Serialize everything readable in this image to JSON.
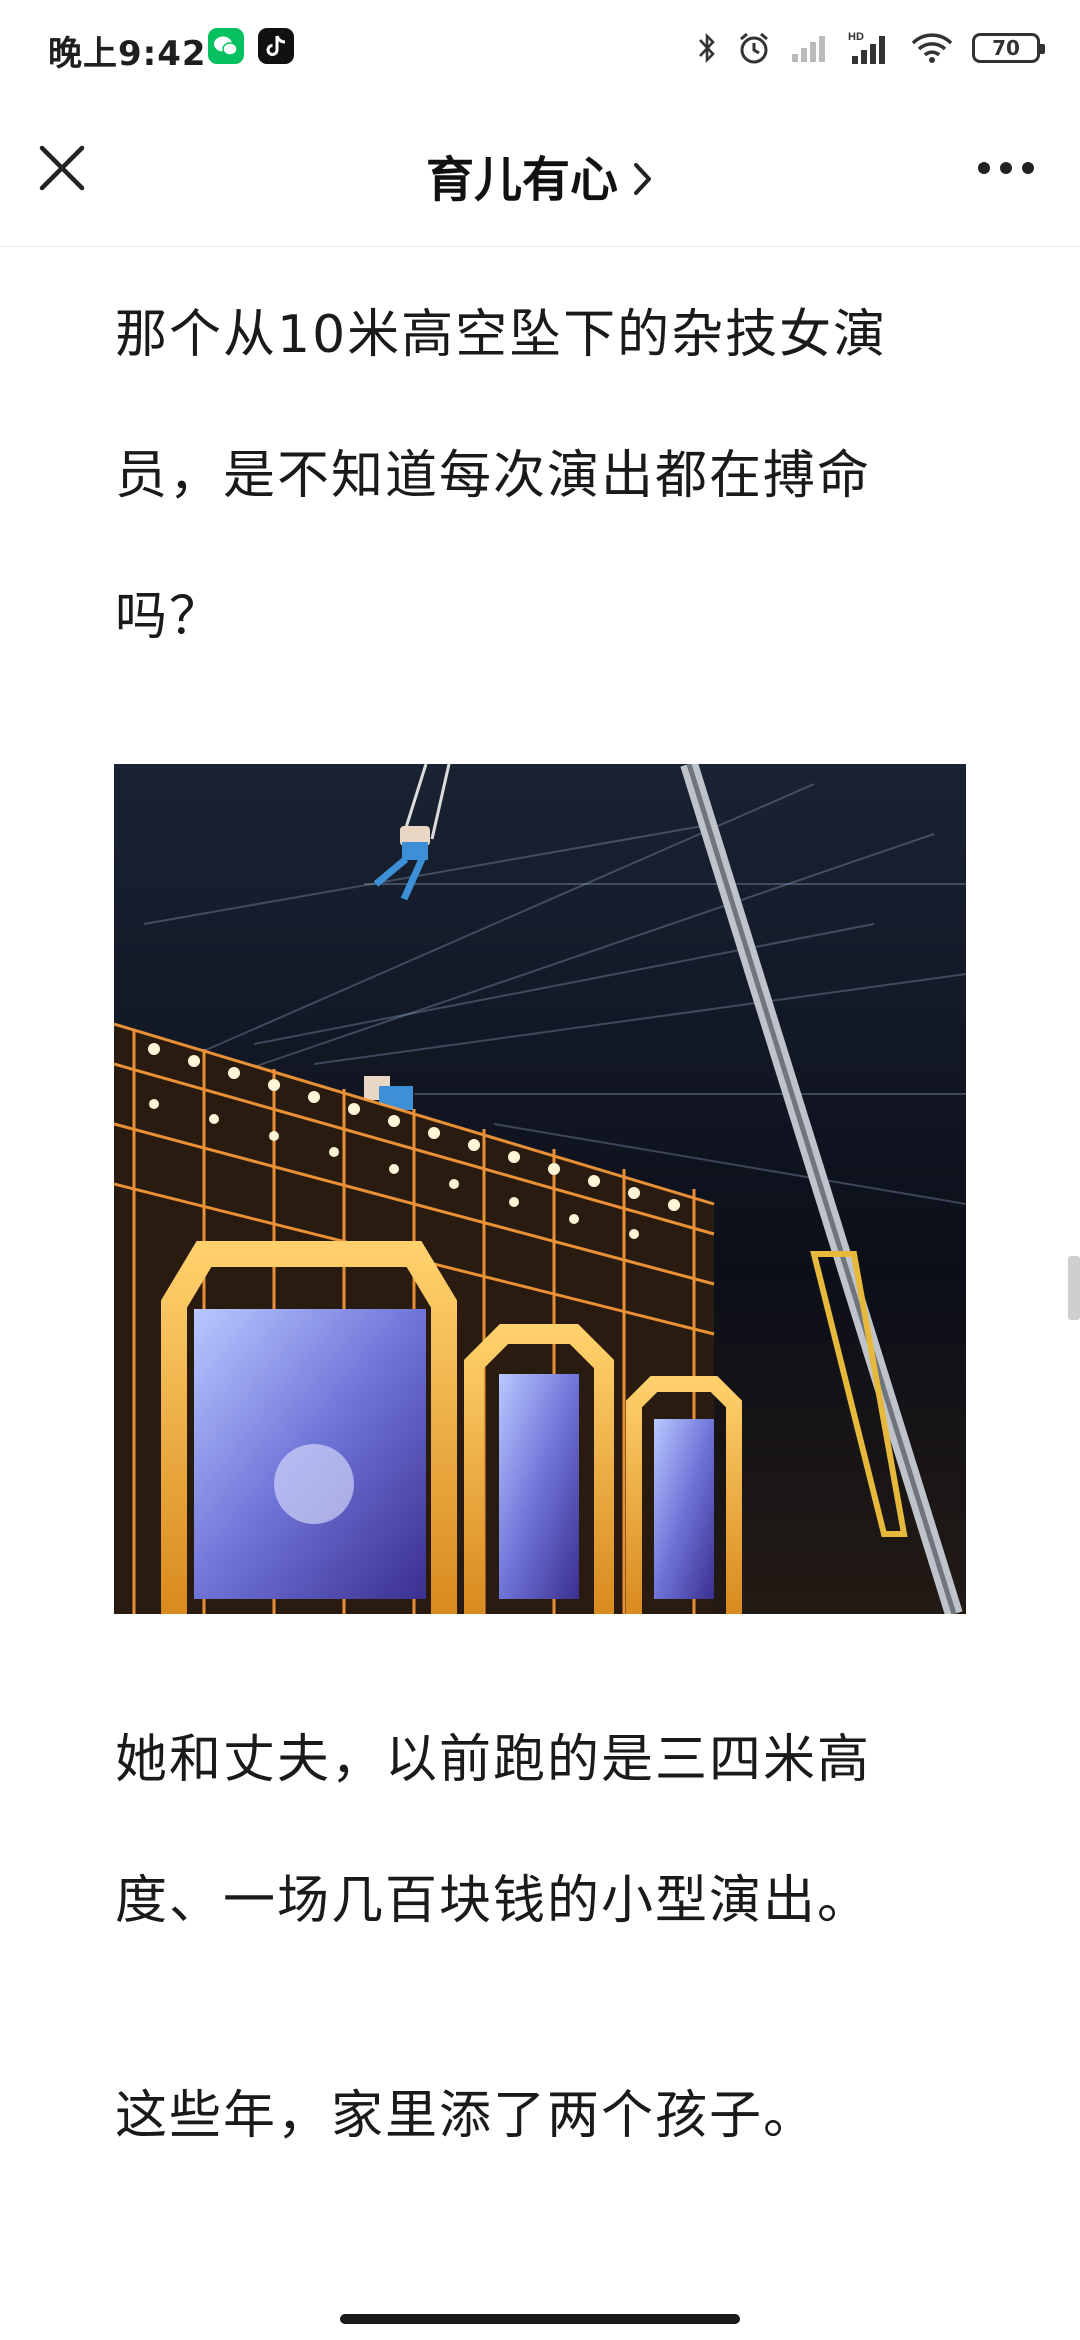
{
  "status_bar": {
    "time": "晚上9:42",
    "battery": "70",
    "icons": [
      "wechat-icon",
      "douyin-icon",
      "bluetooth-icon",
      "alarm-icon",
      "signal-icon",
      "hd-signal-icon",
      "wifi-icon",
      "battery-icon"
    ]
  },
  "nav": {
    "title": "育儿有心",
    "close_icon": "close-icon",
    "chevron_icon": "chevron-right-icon",
    "more_icon": "more-icon"
  },
  "article": {
    "paragraph_1": "那个从10米高空坠下的杂技女演员，是不知道每次演出都在搏命吗？",
    "image_description_icon": "acrobat-photo",
    "paragraph_2": "她和丈夫，以前跑的是三四米高度、一场几百块钱的小型演出。",
    "paragraph_3": "这些年，家里添了两个孩子。"
  },
  "colors": {
    "wechat_green": "#07c160",
    "text": "#1a1a1a",
    "divider": "#ececec"
  }
}
